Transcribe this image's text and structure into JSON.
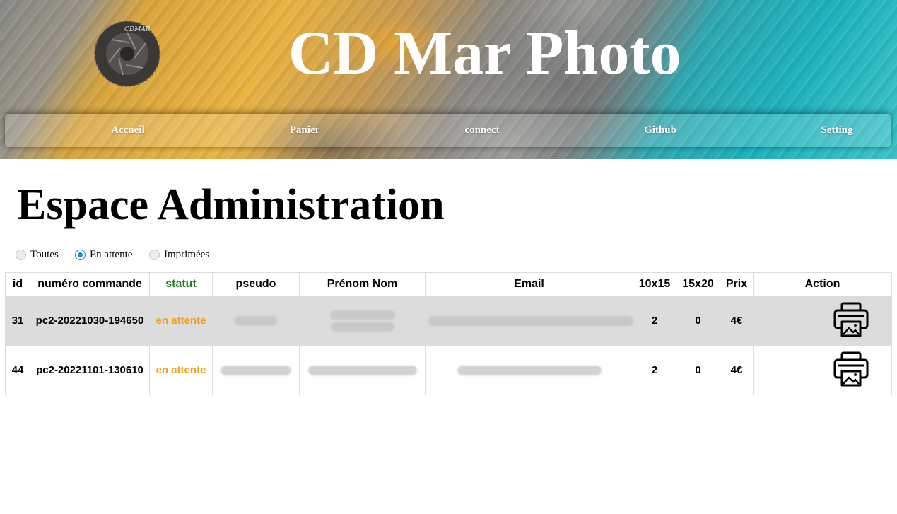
{
  "header": {
    "site_title": "CD Mar Photo",
    "logo_alt": "aperture-logo"
  },
  "nav": {
    "items": [
      {
        "label": "Accueil"
      },
      {
        "label": "Panier"
      },
      {
        "label": "connect"
      },
      {
        "label": "Github"
      },
      {
        "label": "Setting"
      }
    ]
  },
  "page": {
    "title": "Espace Administration"
  },
  "filters": {
    "options": [
      {
        "label": "Toutes",
        "checked": false
      },
      {
        "label": "En attente",
        "checked": true
      },
      {
        "label": "Imprimées",
        "checked": false
      }
    ]
  },
  "table": {
    "headers": {
      "id": "id",
      "order_number": "numéro commande",
      "status": "statut",
      "pseudo": "pseudo",
      "name": "Prénom Nom",
      "email": "Email",
      "size_10x15": "10x15",
      "size_15x20": "15x20",
      "price": "Prix",
      "action": "Action"
    },
    "rows": [
      {
        "id": "31",
        "order_number": "pc2-20221030-194650",
        "status": "en attente",
        "size_10x15": "2",
        "size_15x20": "0",
        "price": "4€"
      },
      {
        "id": "44",
        "order_number": "pc2-20221101-130610",
        "status": "en attente",
        "size_10x15": "2",
        "size_15x20": "0",
        "price": "4€"
      }
    ]
  },
  "colors": {
    "status_header": "#1e7e1e",
    "status_pending": "#f0a020",
    "radio_checked": "#1590d0",
    "row_alt": "#dcdcdc"
  },
  "icons": {
    "print_action": "printer-photo-icon"
  }
}
